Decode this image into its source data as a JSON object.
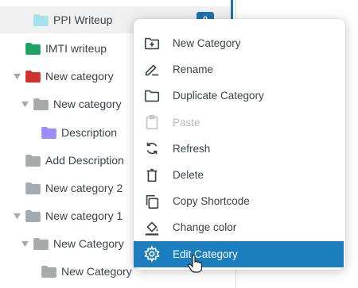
{
  "colors": {
    "accent": "#2271b1",
    "menu_highlight": "#1b7fbf",
    "folder_gray": "#a7aaad",
    "folder_light_blue": "#a6e1ec",
    "folder_green": "#1aa364",
    "folder_red": "#d32f2f",
    "folder_purple": "#9b8cff"
  },
  "tree": {
    "items": [
      {
        "label": "PPI Writeup",
        "folder_color": "#a6e1ec",
        "expanded": null,
        "count": "0"
      },
      {
        "label": "IMTI writeup",
        "folder_color": "#1aa364",
        "expanded": null
      },
      {
        "label": "New category",
        "folder_color": "#d32f2f",
        "expanded": true
      },
      {
        "label": "New category",
        "folder_color": "#a7aaad",
        "expanded": true
      },
      {
        "label": "Description",
        "folder_color": "#9b8cff",
        "expanded": null
      },
      {
        "label": "Add Description",
        "folder_color": "#a7aaad",
        "expanded": null
      },
      {
        "label": "New category 2",
        "folder_color": "#a7aaad",
        "expanded": null
      },
      {
        "label": "New category 1",
        "folder_color": "#a7aaad",
        "expanded": true
      },
      {
        "label": "New Category",
        "folder_color": "#a7aaad",
        "expanded": true
      },
      {
        "label": "New Category",
        "folder_color": "#a7aaad",
        "expanded": null
      }
    ]
  },
  "context_menu": {
    "items": [
      {
        "label": "New Category",
        "icon": "folder-plus-icon",
        "disabled": false
      },
      {
        "label": "Rename",
        "icon": "pencil-line-icon",
        "disabled": false
      },
      {
        "label": "Duplicate Category",
        "icon": "folder-outline-icon",
        "disabled": false
      },
      {
        "label": "Paste",
        "icon": "clipboard-icon",
        "disabled": true
      },
      {
        "label": "Refresh",
        "icon": "refresh-icon",
        "disabled": false
      },
      {
        "label": "Delete",
        "icon": "trash-icon",
        "disabled": false
      },
      {
        "label": "Copy Shortcode",
        "icon": "copy-icon",
        "disabled": false
      },
      {
        "label": "Change color",
        "icon": "paint-bucket-icon",
        "disabled": false
      },
      {
        "label": "Edit Category",
        "icon": "gear-icon",
        "disabled": false,
        "active": true
      }
    ]
  }
}
